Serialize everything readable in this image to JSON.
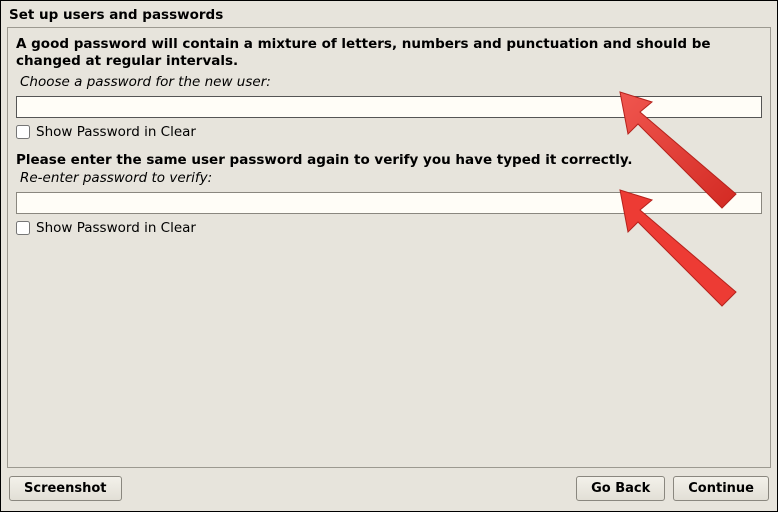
{
  "title": "Set up users and passwords",
  "section1": {
    "description": "A good password will contain a mixture of letters, numbers and punctuation and should be changed at regular intervals.",
    "prompt": "Choose a password for the new user:",
    "value": "",
    "show_clear_label": "Show Password in Clear",
    "show_clear_checked": false
  },
  "section2": {
    "description": "Please enter the same user password again to verify you have typed it correctly.",
    "prompt": "Re-enter password to verify:",
    "value": "",
    "show_clear_label": "Show Password in Clear",
    "show_clear_checked": false
  },
  "footer": {
    "screenshot_label": "Screenshot",
    "goback_label": "Go Back",
    "continue_label": "Continue"
  },
  "colors": {
    "bg": "#e7e4dc",
    "input_bg": "#fffdf7",
    "border": "#8a877f",
    "arrow": "#ed3b34"
  }
}
